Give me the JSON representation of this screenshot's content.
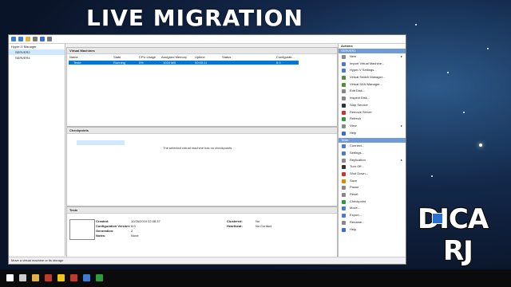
{
  "banner": {
    "title": "LIVE MIGRATION"
  },
  "logo": {
    "line1": "DICA",
    "line2": "RJ"
  },
  "tree": {
    "root": "Hyper-V Manager",
    "servers": [
      "SERVER2",
      "SERVER4"
    ]
  },
  "vm_panel": {
    "title": "Virtual Machines",
    "columns": [
      "Name",
      "State",
      "CPU Usage",
      "Assigned Memory",
      "Uptime",
      "Status",
      "Configurati..."
    ],
    "row": {
      "name": "Teste",
      "state": "Running",
      "cpu": "0%",
      "memory": "1024 MB",
      "uptime": "00:00:11",
      "status": "",
      "config": "8.0"
    }
  },
  "checkpoints_panel": {
    "title": "Checkpoints",
    "empty_message": "The selected virtual machine has no checkpoints."
  },
  "details_panel": {
    "title": "Teste",
    "created_label": "Created:",
    "created_value": "10/26/2019 02:08:37",
    "config_label": "Configuration Version:",
    "config_value": "8.0",
    "gen_label": "Generation:",
    "gen_value": "2",
    "notes_label": "Notes:",
    "notes_value": "None",
    "clustered_label": "Clustered:",
    "clustered_value": "No",
    "heartbeat_label": "Heartbeat:",
    "heartbeat_value": "No Contact",
    "tabs": [
      "Summary",
      "Memory",
      "Networking",
      "Replication"
    ]
  },
  "status_bar": "Move a virtual machine or its storage",
  "actions": {
    "title": "Actions",
    "server_section": "SERVER2",
    "server_items": [
      {
        "label": "New",
        "icon": "new-icon",
        "submenu": true,
        "color": "#888888"
      },
      {
        "label": "Import Virtual Machine...",
        "icon": "import-icon",
        "submenu": false,
        "color": "#4a7cc7"
      },
      {
        "label": "Hyper-V Settings...",
        "icon": "settings-icon",
        "submenu": false,
        "color": "#4a7cc7"
      },
      {
        "label": "Virtual Switch Manager...",
        "icon": "switch-icon",
        "submenu": false,
        "color": "#5a8a3a"
      },
      {
        "label": "Virtual SAN Manager...",
        "icon": "san-icon",
        "submenu": false,
        "color": "#5a8a3a"
      },
      {
        "label": "Edit Disk...",
        "icon": "edit-disk-icon",
        "submenu": false,
        "color": "#888888"
      },
      {
        "label": "Inspect Disk...",
        "icon": "inspect-disk-icon",
        "submenu": false,
        "color": "#888888"
      },
      {
        "label": "Stop Service",
        "icon": "stop-icon",
        "submenu": false,
        "color": "#333333"
      },
      {
        "label": "Remove Server",
        "icon": "remove-icon",
        "submenu": false,
        "color": "#d03030"
      },
      {
        "label": "Refresh",
        "icon": "refresh-icon",
        "submenu": false,
        "color": "#2e9a3a"
      },
      {
        "label": "View",
        "icon": "view-icon",
        "submenu": true,
        "color": "#888888"
      },
      {
        "label": "Help",
        "icon": "help-icon",
        "submenu": false,
        "color": "#3a6fd0"
      }
    ],
    "vm_section": "Teste",
    "vm_items": [
      {
        "label": "Connect...",
        "icon": "connect-icon",
        "submenu": false,
        "color": "#4a7cc7"
      },
      {
        "label": "Settings...",
        "icon": "settings-icon",
        "submenu": false,
        "color": "#4a7cc7"
      },
      {
        "label": "Replication",
        "icon": "replication-icon",
        "submenu": true,
        "color": "#888888"
      },
      {
        "label": "Turn Off...",
        "icon": "turn-off-icon",
        "submenu": false,
        "color": "#333333"
      },
      {
        "label": "Shut Down...",
        "icon": "shut-down-icon",
        "submenu": false,
        "color": "#d03030"
      },
      {
        "label": "Save",
        "icon": "save-icon",
        "submenu": false,
        "color": "#e08a00"
      },
      {
        "label": "Pause",
        "icon": "pause-icon",
        "submenu": false,
        "color": "#888888"
      },
      {
        "label": "Reset",
        "icon": "reset-icon",
        "submenu": false,
        "color": "#888888"
      },
      {
        "label": "Checkpoint",
        "icon": "checkpoint-icon",
        "submenu": false,
        "color": "#2e9a3a"
      },
      {
        "label": "Move...",
        "icon": "move-icon",
        "submenu": false,
        "color": "#4a7cc7"
      },
      {
        "label": "Export...",
        "icon": "export-icon",
        "submenu": false,
        "color": "#4a7cc7"
      },
      {
        "label": "Rename...",
        "icon": "rename-icon",
        "submenu": false,
        "color": "#888888"
      },
      {
        "label": "Help",
        "icon": "help-icon",
        "submenu": false,
        "color": "#3a6fd0"
      }
    ]
  }
}
